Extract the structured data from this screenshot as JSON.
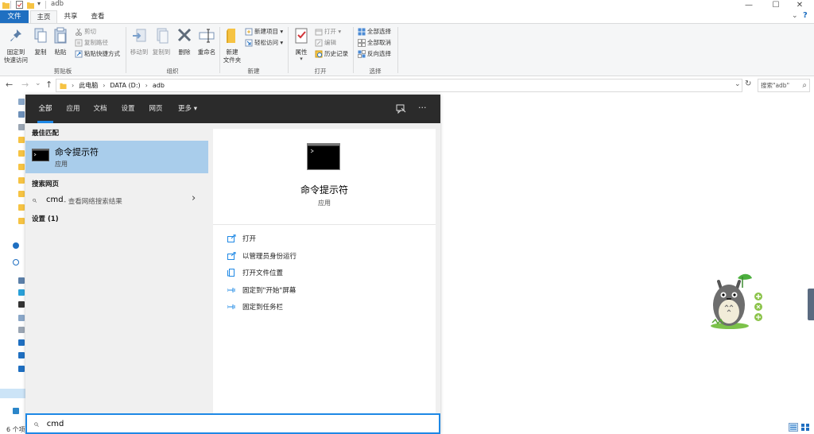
{
  "window": {
    "title": "adb",
    "controls": {
      "minimize": "—",
      "maximize": "☐",
      "close": "✕"
    }
  },
  "ribbon": {
    "tabs": [
      "文件",
      "主页",
      "共享",
      "查看"
    ],
    "active_tab": "主页",
    "groups": {
      "clipboard": {
        "label": "剪贴板",
        "pin": "固定到\n快速访问",
        "copy": "复制",
        "paste": "粘贴",
        "cut": "剪切",
        "copy_path": "复制路径",
        "paste_shortcut": "粘贴快捷方式"
      },
      "organize": {
        "label": "组织",
        "move_to": "移动到",
        "copy_to": "复制到",
        "delete": "删除",
        "rename": "重命名"
      },
      "new": {
        "label": "新建",
        "new_folder": "新建\n文件夹",
        "new_item": "新建项目 ▾",
        "easy_access": "轻松访问 ▾"
      },
      "open": {
        "label": "打开",
        "properties": "属性",
        "open": "打开 ▾",
        "edit": "编辑",
        "history": "历史记录"
      },
      "select": {
        "label": "选择",
        "select_all": "全部选择",
        "select_none": "全部取消",
        "invert": "反向选择"
      }
    }
  },
  "address": {
    "back": "←",
    "forward": "→",
    "recent": "⌄",
    "up": "↑",
    "breadcrumb": [
      "此电脑",
      "DATA (D:)",
      "adb"
    ],
    "dropdown": "⌄",
    "refresh": "↻",
    "search_placeholder": "搜索\"adb\"",
    "search_icon": "⌕"
  },
  "status_bar": {
    "items_text": "6 个项"
  },
  "search_panel": {
    "tabs": [
      "全部",
      "应用",
      "文档",
      "设置",
      "网页",
      "更多 ▾"
    ],
    "active_tab": "全部",
    "header_icons": [
      "feedback-icon",
      "more-icon"
    ],
    "more_glyph": "···",
    "left": {
      "best_match_heading": "最佳匹配",
      "best_match": {
        "name": "命令提示符",
        "type": "应用"
      },
      "web_heading": "搜索网页",
      "web_query": "cmd",
      "web_hint": " - 查看网络搜索结果",
      "web_arrow": "›",
      "settings_heading": "设置 (1)"
    },
    "right": {
      "app_name": "命令提示符",
      "app_type": "应用",
      "actions": [
        "打开",
        "以管理员身份运行",
        "打开文件位置",
        "固定到\"开始\"屏幕",
        "固定到任务栏"
      ]
    },
    "query": "cmd"
  },
  "colors": {
    "accent": "#1e88e5",
    "file_tab": "#1f6fc1",
    "selected": "#a9cdeb",
    "search_header": "#2b2b2b"
  }
}
